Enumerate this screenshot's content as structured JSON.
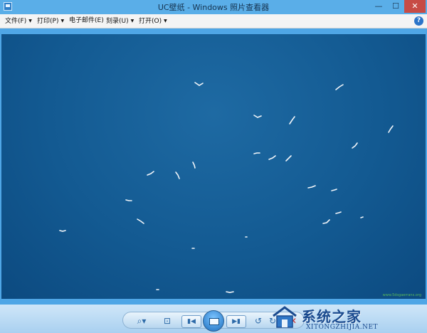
{
  "window": {
    "title": "UC壁纸 - Windows 照片查看器",
    "minimize_glyph": "—",
    "maximize_glyph": "☐",
    "close_glyph": "✕"
  },
  "toolbar": {
    "items": [
      {
        "label": "文件(F)"
      },
      {
        "label": "打印(P)"
      },
      {
        "label": "电子邮件(E)"
      },
      {
        "label": "刻录(U)"
      },
      {
        "label": "打开(O)"
      }
    ],
    "help_glyph": "?"
  },
  "photo": {
    "watermark": "www.5dsgaerrans.org",
    "colors": {
      "sky": "#135a92",
      "bird": "#f2f6fa"
    }
  },
  "controls": {
    "zoom_glyph": "⌕▾",
    "fit_glyph": "⊡",
    "prev_glyph": "▮◀",
    "next_glyph": "▶▮",
    "rotate_left_glyph": "↺",
    "rotate_right_glyph": "↻",
    "delete_glyph": "✕"
  },
  "logo": {
    "text": "系统之家",
    "url_text": "XITONGZHIJIA.NET"
  },
  "colors": {
    "accent": "#4fa6e6",
    "close": "#c74b45"
  }
}
